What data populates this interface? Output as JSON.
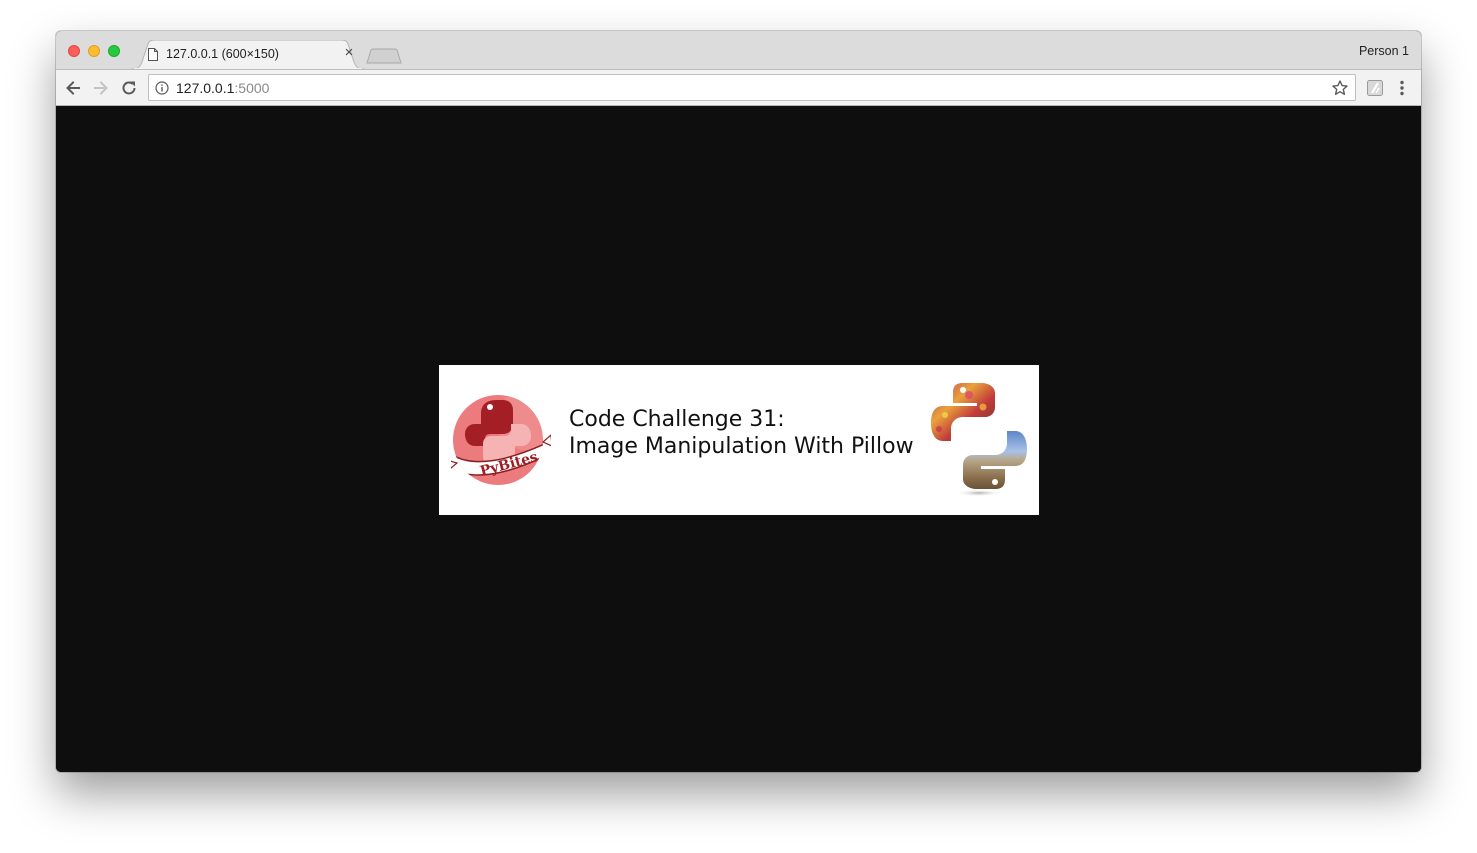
{
  "browser": {
    "tab": {
      "title": "127.0.0.1 (600×150)",
      "close_glyph": "×",
      "favicon": "document-icon"
    },
    "profile_label": "Person 1",
    "address_bar": {
      "host": "127.0.0.1",
      "port": ":5000",
      "security_icon": "info-icon",
      "bookmark_icon": "star-icon"
    },
    "nav": {
      "back_icon": "arrow-left-icon",
      "forward_icon": "arrow-right-icon",
      "reload_icon": "reload-icon",
      "extension_icon": "extension-icon",
      "menu_icon": "kebab-menu-icon"
    }
  },
  "page": {
    "background": "#0e0e0e",
    "banner": {
      "title_line1": "Code Challenge 31:",
      "title_line2": "Image Manipulation With Pillow",
      "left_logo_text": "PyBites",
      "right_logo": "python-logo-photo-collage"
    }
  },
  "colors": {
    "pybites_red": "#e8676a",
    "pybites_dark": "#a01c22",
    "tabstrip": "#dcdcdc",
    "toolbar": "#f2f2f2"
  }
}
